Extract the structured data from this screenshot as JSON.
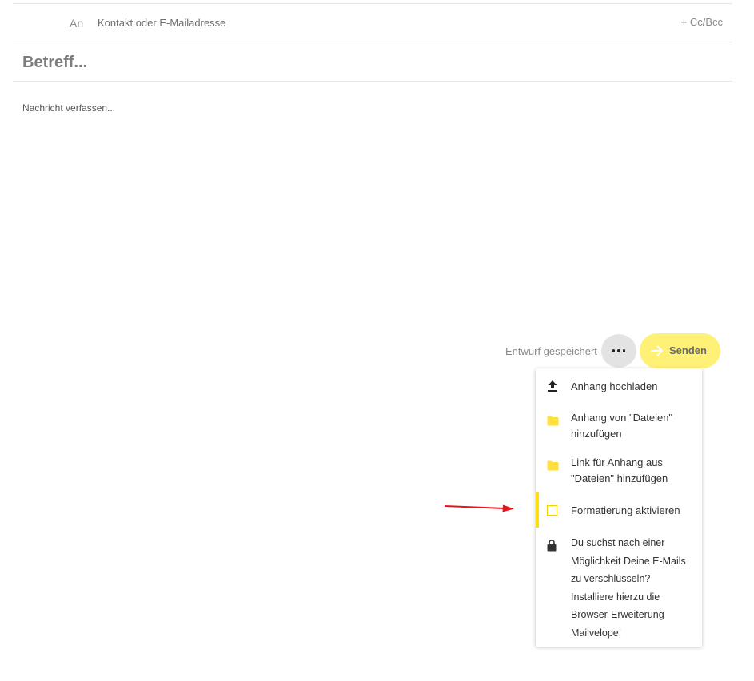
{
  "compose": {
    "to_label": "An",
    "to_placeholder": "Kontakt oder E-Mailadresse",
    "cc_bcc": "+ Cc/Bcc",
    "subject_placeholder": "Betreff...",
    "body_placeholder": "Nachricht verfassen..."
  },
  "footer": {
    "draft_status": "Entwurf gespeichert",
    "send_label": "Senden"
  },
  "menu": {
    "items": [
      {
        "icon": "upload-icon",
        "label": "Anhang hochladen"
      },
      {
        "icon": "folder-icon",
        "label": "Anhang von \"Dateien\" hinzufügen"
      },
      {
        "icon": "folder-icon",
        "label": "Link für Anhang aus \"Dateien\" hinzufügen"
      },
      {
        "icon": "checkbox",
        "label": "Formatierung aktivieren",
        "checked": false,
        "active": true
      },
      {
        "icon": "lock-icon",
        "label": "Du suchst nach einer Möglichkeit Deine E-Mails zu verschlüsseln? Installiere hierzu die Browser-Erweiterung Mailvelope!"
      }
    ]
  },
  "colors": {
    "accent_yellow": "#ffe000",
    "send_button": "#fff176",
    "annotation_arrow": "#e8141b"
  }
}
